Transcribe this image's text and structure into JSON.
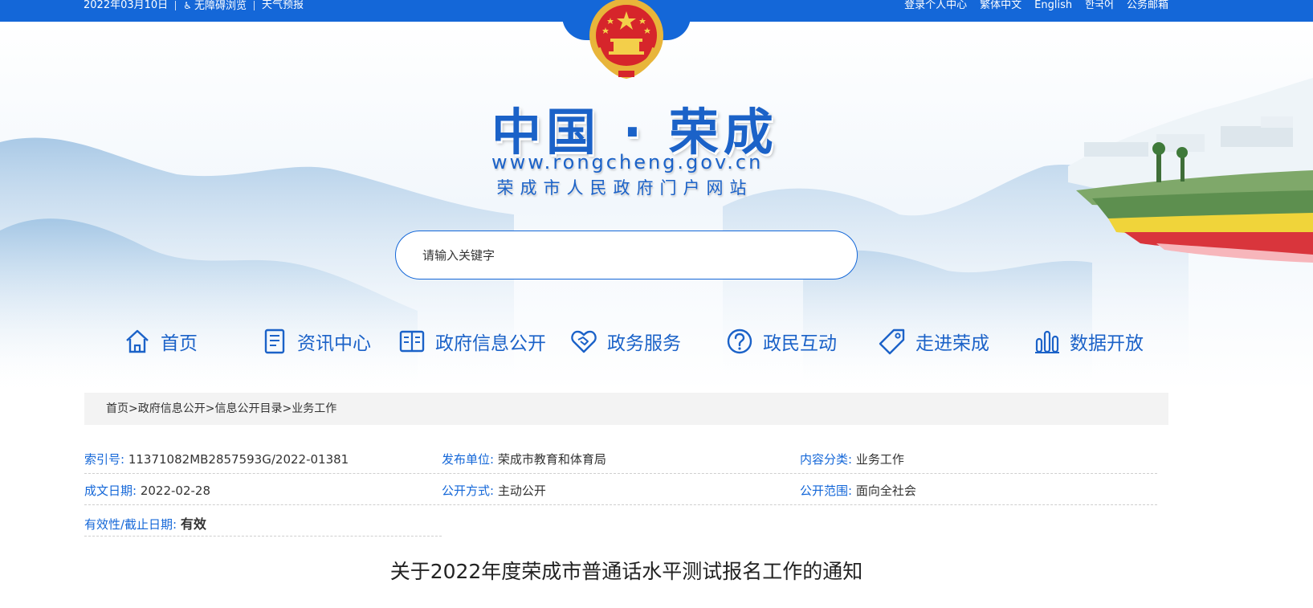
{
  "topbar": {
    "date": "2022年03月10日",
    "accessibility": "无障碍浏览",
    "weather": "天气预报",
    "links": [
      "登录个人中心",
      "繁体中文",
      "English",
      "한국어",
      "公务邮箱"
    ]
  },
  "site": {
    "title": "中国 · 荣成",
    "url": "www.rongcheng.gov.cn",
    "subtitle": "荣成市人民政府门户网站"
  },
  "search": {
    "placeholder": "请输入关键字"
  },
  "nav": [
    {
      "label": "首页",
      "icon": "home-icon"
    },
    {
      "label": "资讯中心",
      "icon": "news-icon"
    },
    {
      "label": "政府信息公开",
      "icon": "book-icon"
    },
    {
      "label": "政务服务",
      "icon": "handshake-icon"
    },
    {
      "label": "政民互动",
      "icon": "question-icon"
    },
    {
      "label": "走进荣成",
      "icon": "tag-icon"
    },
    {
      "label": "数据开放",
      "icon": "bar-chart-icon"
    }
  ],
  "breadcrumb": "首页>政府信息公开>信息公开目录>业务工作",
  "meta": {
    "index_label": "索引号:",
    "index_value": "11371082MB2857593G/2022-01381",
    "publisher_label": "发布单位:",
    "publisher_value": "荣成市教育和体育局",
    "category_label": "内容分类:",
    "category_value": "业务工作",
    "date_label": "成文日期:",
    "date_value": "2022-02-28",
    "method_label": "公开方式:",
    "method_value": "主动公开",
    "scope_label": "公开范围:",
    "scope_value": "面向全社会",
    "validity_label": "有效性/截止日期:",
    "validity_value": "有效"
  },
  "article": {
    "title": "关于2022年度荣成市普通话水平测试报名工作的通知"
  },
  "colors": {
    "brand_blue": "#1467d8",
    "title_blue": "#1b62c8"
  }
}
